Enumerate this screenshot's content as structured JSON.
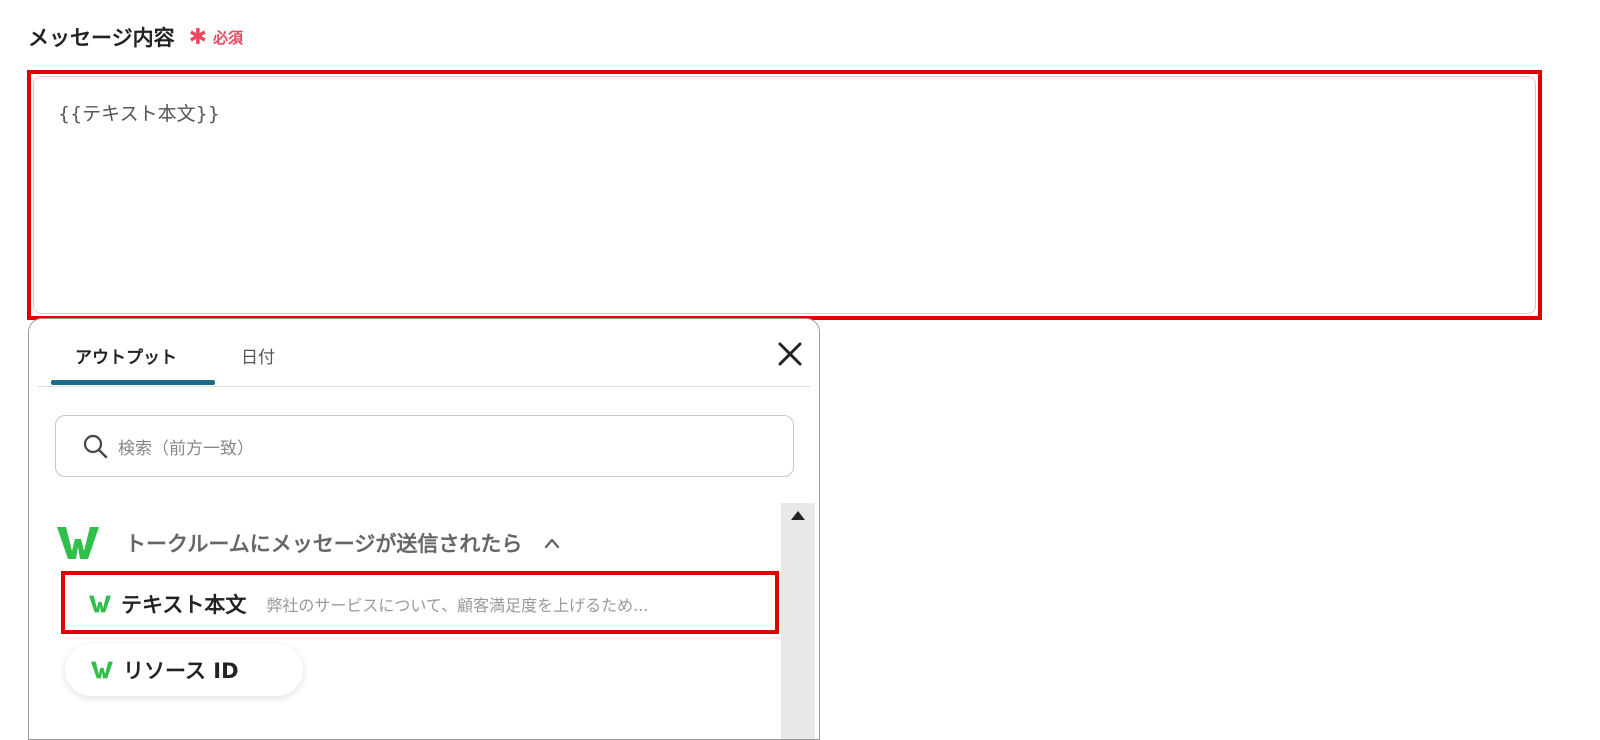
{
  "field": {
    "label": "メッセージ内容",
    "required_star": "✱",
    "required_text": "必須",
    "value": "{{テキスト本文}}"
  },
  "popup": {
    "tabs": [
      {
        "label": "アウトプット",
        "active": true
      },
      {
        "label": "日付",
        "active": false
      }
    ],
    "search_placeholder": "検索（前方一致）",
    "group": {
      "title": "トークルームにメッセージが送信されたら",
      "items": [
        {
          "label": "テキスト本文",
          "preview": "弊社のサービスについて、顧客満足度を上げるため..."
        },
        {
          "label": "リソース ID",
          "preview": ""
        }
      ]
    }
  },
  "colors": {
    "highlight": "#e00000",
    "required": "#e8485f",
    "tab_accent": "#1b6c86",
    "logo_green": "#2fbf4a"
  }
}
